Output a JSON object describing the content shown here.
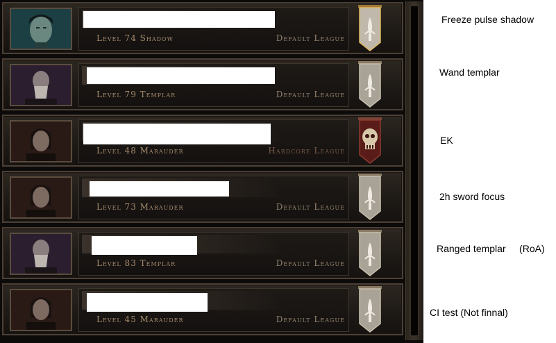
{
  "characters": [
    {
      "level_label": "Level 74 Shadow",
      "league": "Default League",
      "portrait": "shadow-portrait",
      "emblem": "default-league-banner-icon"
    },
    {
      "level_label": "Level 79 Templar",
      "league": "Default League",
      "portrait": "templar-portrait",
      "emblem": "default-league-banner-icon"
    },
    {
      "level_label": "Level 48 Marauder",
      "league": "Hardcore League",
      "portrait": "marauder-portrait",
      "emblem": "hardcore-league-skull-icon"
    },
    {
      "level_label": "Level 73 Marauder",
      "league": "Default League",
      "portrait": "marauder-portrait",
      "emblem": "default-league-banner-icon"
    },
    {
      "level_label": "Level 83 Templar",
      "league": "Default League",
      "portrait": "templar-portrait",
      "emblem": "default-league-banner-icon"
    },
    {
      "level_label": "Level 45 Marauder",
      "league": "Default League",
      "portrait": "marauder-portrait",
      "emblem": "default-league-banner-icon"
    }
  ],
  "notes": [
    "Freeze pulse shadow",
    "Wand templar",
    "EK",
    "2h sword focus",
    "Ranged templar     (RoA)",
    "CI test (Not finnal)"
  ],
  "colors": {
    "default_league_text": "#978671",
    "hardcore_league_text": "#7a5a4a",
    "level_text": "#a58b6c"
  }
}
